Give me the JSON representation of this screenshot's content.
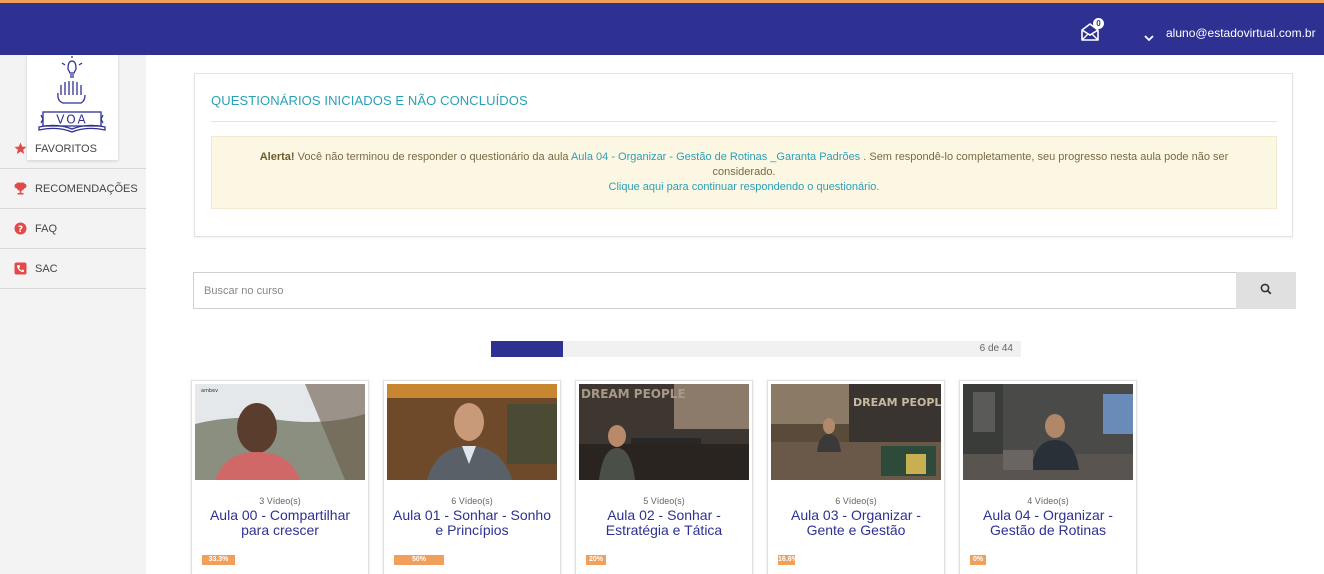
{
  "header": {
    "user_email": "aluno@estadovirtual.com.br",
    "mail_badge_count": "0",
    "mail_icon": "envelope-open-icon",
    "user_menu_icon": "chevron-down-icon"
  },
  "logo": {
    "text": "VOA"
  },
  "colors": {
    "primary": "#2e3192",
    "accent": "#f0a05a",
    "link": "#2aa0b8",
    "alert_bg": "#fcf7e3"
  },
  "sidebar": {
    "items": [
      {
        "label": "FAVORITOS",
        "icon": "star-icon"
      },
      {
        "label": "RECOMENDAÇÕES",
        "icon": "trophy-icon"
      },
      {
        "label": "FAQ",
        "icon": "question-circle-icon"
      },
      {
        "label": "SAC",
        "icon": "phone-icon"
      }
    ]
  },
  "questionnaires": {
    "title": "QUESTIONÁRIOS INICIADOS E NÃO CONCLUÍDOS",
    "alert_strong": "Alerta!",
    "alert_text_1": " Você não terminou de responder o questionário da aula ",
    "alert_lesson_link": "Aula 04 - Organizar - Gestão de Rotinas _Garanta Padrões",
    "alert_text_2": " . Sem respondê-lo completamente, seu progresso nesta aula pode não ser considerado.",
    "continue_link": "Clique aqui para continuar respondendo o questionário."
  },
  "search": {
    "placeholder": "Buscar no curso",
    "icon": "search-icon"
  },
  "progress": {
    "current": 6,
    "total": 44,
    "text": "6 de 44"
  },
  "lessons": [
    {
      "videos": "3 Vídeo(s)",
      "title": "Aula 00 - Compartilhar para crescer",
      "progress_label": "33.3%",
      "progress": 0.333
    },
    {
      "videos": "6 Vídeo(s)",
      "title": "Aula 01 - Sonhar - Sonho e Princípios",
      "progress_label": "50%",
      "progress": 0.5
    },
    {
      "videos": "5 Vídeo(s)",
      "title": "Aula 02 - Sonhar - Estratégia e Tática",
      "progress_label": "20%",
      "progress": 0.2
    },
    {
      "videos": "6 Vídeo(s)",
      "title": "Aula 03 - Organizar - Gente e Gestão",
      "progress_label": "16.6%",
      "progress": 0.166
    },
    {
      "videos": "4 Vídeo(s)",
      "title": "Aula 04 - Organizar - Gestão de Rotinas",
      "progress_label": "0%",
      "progress": 0
    }
  ],
  "thumbnail_texts": {
    "t0": "ambev",
    "t2": "DREAM PEOPLE",
    "t3": "DREAM PEOPLE"
  }
}
